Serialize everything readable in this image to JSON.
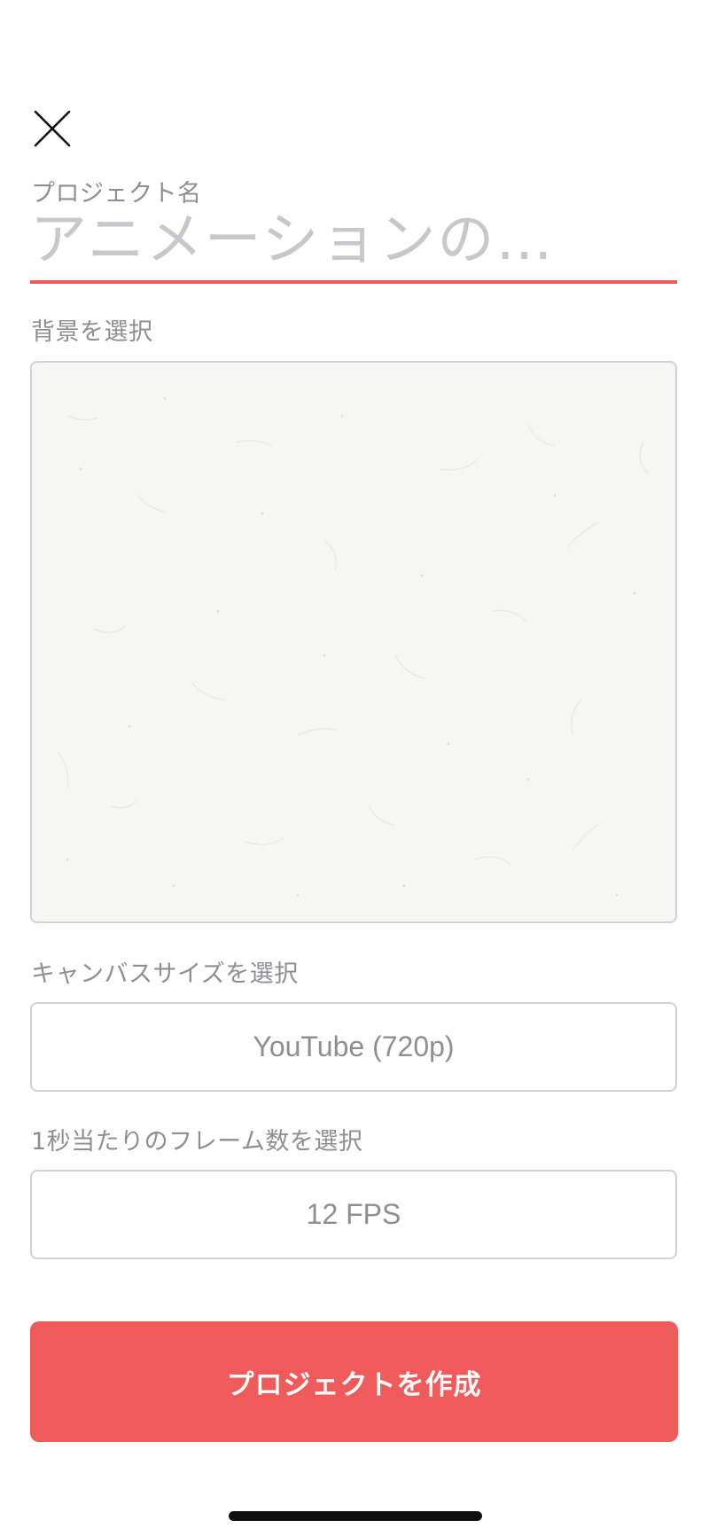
{
  "form": {
    "project_name_label": "プロジェクト名",
    "project_name_placeholder": "アニメーションの…",
    "project_name_value": "",
    "background_label": "背景を選択",
    "canvas_size_label": "キャンバスサイズを選択",
    "canvas_size_value": "YouTube (720p)",
    "fps_label": "1秒当たりのフレーム数を選択",
    "fps_value": "12 FPS"
  },
  "actions": {
    "create_label": "プロジェクトを作成",
    "close_icon": "close-icon"
  },
  "colors": {
    "accent": "#ef5a5a",
    "label": "#8e8e93",
    "border": "#d1d1d6",
    "placeholder": "#c8c8cc",
    "paper": "#f6f6f4"
  }
}
